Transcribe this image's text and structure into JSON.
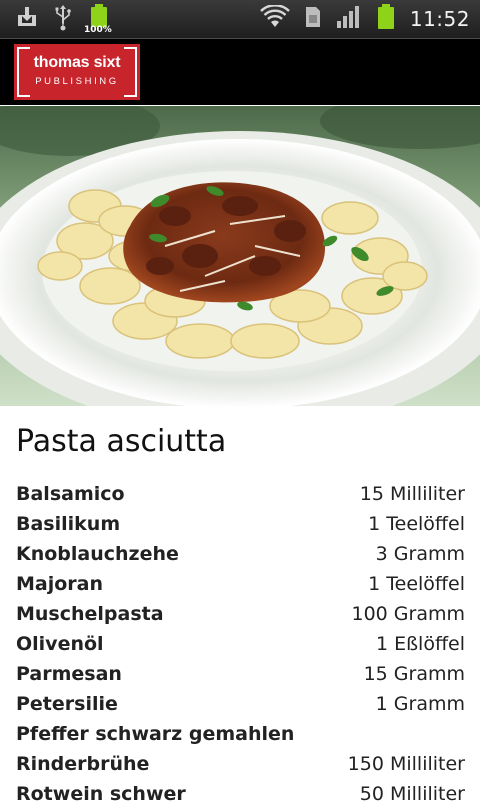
{
  "status_bar": {
    "battery_percent": "100%",
    "time": "11:52",
    "icons": [
      "download-icon",
      "usb-icon",
      "battery-charging-icon",
      "wifi-icon",
      "sim-icon",
      "signal-icon",
      "battery-icon"
    ],
    "colors": {
      "green": "#8ed319"
    }
  },
  "header": {
    "logo_name": "thomas sixt",
    "logo_sub": "PUBLISHING",
    "brand_color": "#c8242b"
  },
  "recipe": {
    "title": "Pasta asciutta",
    "ingredients": [
      {
        "name": "Balsamico",
        "amount": "15 Milliliter"
      },
      {
        "name": "Basilikum",
        "amount": "1 Teelöffel"
      },
      {
        "name": "Knoblauchzehe",
        "amount": "3 Gramm"
      },
      {
        "name": "Majoran",
        "amount": "1 Teelöffel"
      },
      {
        "name": "Muschelpasta",
        "amount": "100 Gramm"
      },
      {
        "name": "Olivenöl",
        "amount": "1 Eßlöffel"
      },
      {
        "name": "Parmesan",
        "amount": "15 Gramm"
      },
      {
        "name": "Petersilie",
        "amount": "1 Gramm"
      },
      {
        "name": "Pfeffer schwarz gemahlen",
        "amount": ""
      },
      {
        "name": "Rinderbrühe",
        "amount": "150 Milliliter"
      },
      {
        "name": "Rotwein schwer",
        "amount": "50 Milliliter"
      }
    ]
  }
}
